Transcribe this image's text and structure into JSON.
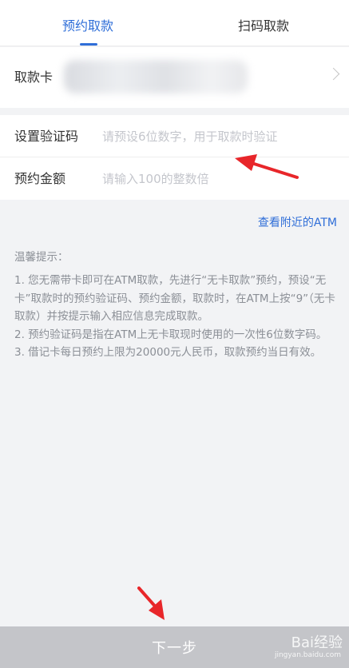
{
  "tabs": [
    {
      "label": "预约取款",
      "active": true
    },
    {
      "label": "扫码取款",
      "active": false
    }
  ],
  "card": {
    "label": "取款卡"
  },
  "form": {
    "code_label": "设置验证码",
    "code_placeholder": "请预设6位数字，用于取款时验证",
    "amount_label": "预约金额",
    "amount_placeholder": "请输入100的整数倍"
  },
  "atm_link": "查看附近的ATM",
  "tips": {
    "title": "温馨提示：",
    "items": [
      "1. 您无需带卡即可在ATM取款，先进行“无卡取款”预约，预设“无卡”取款时的预约验证码、预约金额，取款时，在ATM上按“9”（无卡取款）并按提示输入相应信息完成取款。",
      "2. 预约验证码是指在ATM上无卡取现时使用的一次性6位数字码。",
      "3. 借记卡每日预约上限为20000元人民币，取款预约当日有效。"
    ]
  },
  "next_button": "下一步",
  "watermark": {
    "brand": "Bai经验",
    "url": "jingyan.baidu.com"
  },
  "colors": {
    "accent": "#2f6ed8",
    "arrow": "#e8262a",
    "button_disabled": "#c4c5c9"
  },
  "icons": {
    "card_row": "chevron-right-icon",
    "annotation": "red-arrow"
  }
}
